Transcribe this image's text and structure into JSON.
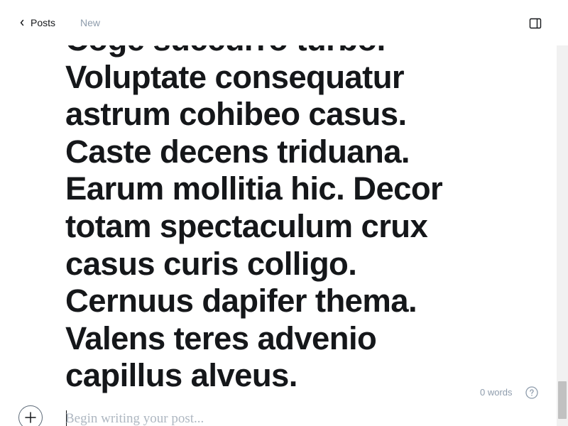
{
  "header": {
    "back_label": "Posts",
    "status": "New"
  },
  "editor": {
    "title_lines": [
      "Coge succurro turbo.",
      "Voluptate consequatur",
      "astrum cohibeo casus.",
      "Caste decens triduana.",
      "Earum mollitia hic. Decor",
      "totam spectaculum crux",
      "casus curis colligo.",
      "Cernuus dapifer thema.",
      "Valens teres advenio",
      "capillus alveus."
    ],
    "body_placeholder": "Begin writing your post...",
    "body_value": "",
    "word_count": "0 words"
  },
  "icons": {
    "back": "chevron-left-icon",
    "sidebar_toggle": "sidebar-panel-icon",
    "help": "question-circle-icon",
    "add_card": "plus-icon"
  },
  "scroll": {
    "position_fraction": 0.98,
    "visible_fraction": 0.1
  },
  "colors": {
    "text": "#15171a",
    "muted": "#8e9cac",
    "placeholder": "#aeb7c1"
  }
}
